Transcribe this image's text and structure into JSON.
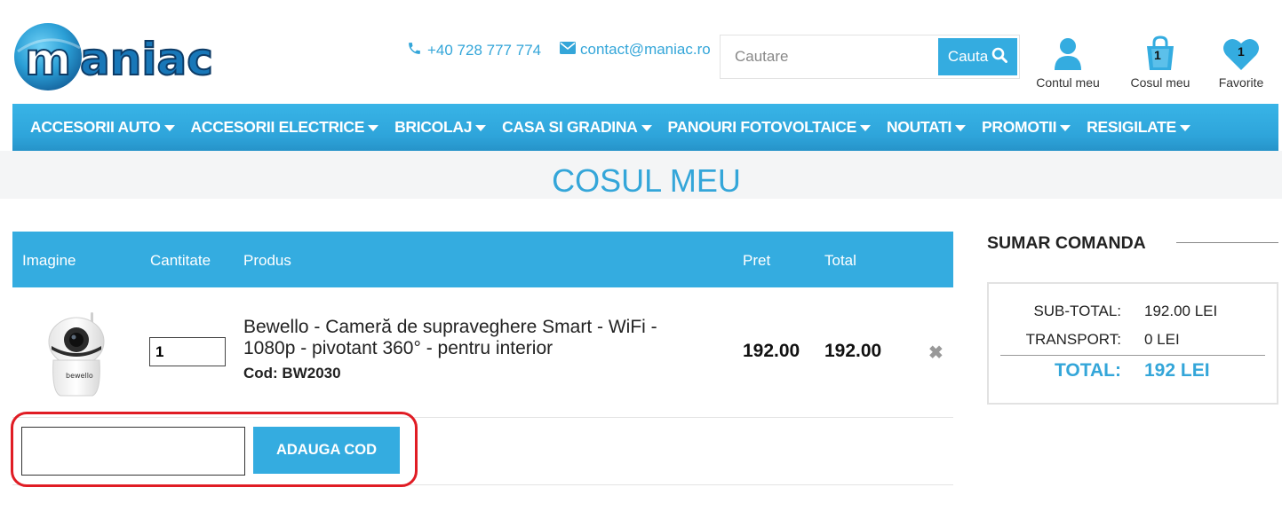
{
  "header": {
    "logo_text": "maniac",
    "phone": "+40 728 777 774",
    "email": "contact@maniac.ro",
    "search_placeholder": "Cautare",
    "search_button": "Cauta",
    "account_label": "Contul meu",
    "cart_label": "Cosul meu",
    "cart_count": "1",
    "favorites_label": "Favorite",
    "favorites_count": "1"
  },
  "nav": {
    "items": [
      "ACCESORII AUTO",
      "ACCESORII ELECTRICE",
      "BRICOLAJ",
      "CASA SI GRADINA",
      "PANOURI FOTOVOLTAICE",
      "NOUTATI",
      "PROMOTII",
      "RESIGILATE"
    ]
  },
  "page": {
    "title": "COSUL MEU"
  },
  "cart": {
    "columns": [
      "Imagine",
      "Cantitate",
      "Produs",
      "Pret",
      "Total"
    ],
    "item": {
      "quantity": "1",
      "name": "Bewello - Cameră de supraveghere Smart - WiFi - 1080p - pivotant 360° - pentru interior",
      "code": "Cod: BW2030",
      "price": "192.00",
      "total": "192.00",
      "remove_symbol": "✖",
      "image_brand": "bewello"
    },
    "coupon": {
      "value": "",
      "button": "ADAUGA COD"
    }
  },
  "summary": {
    "title": "SUMAR COMANDA",
    "subtotal_label": "SUB-TOTAL:",
    "subtotal_value": "192.00 LEI",
    "transport_label": "TRANSPORT:",
    "transport_value": "0 LEI",
    "total_label": "TOTAL:",
    "total_value": "192 LEI"
  },
  "colors": {
    "accent": "#34ace0",
    "highlight_outline": "#e01c24",
    "title_band": "#f4f5f6"
  },
  "icons": [
    "phone-icon",
    "mail-icon",
    "search-icon",
    "user-icon",
    "shopping-bag-icon",
    "heart-icon",
    "caret-down-icon",
    "remove-icon"
  ]
}
